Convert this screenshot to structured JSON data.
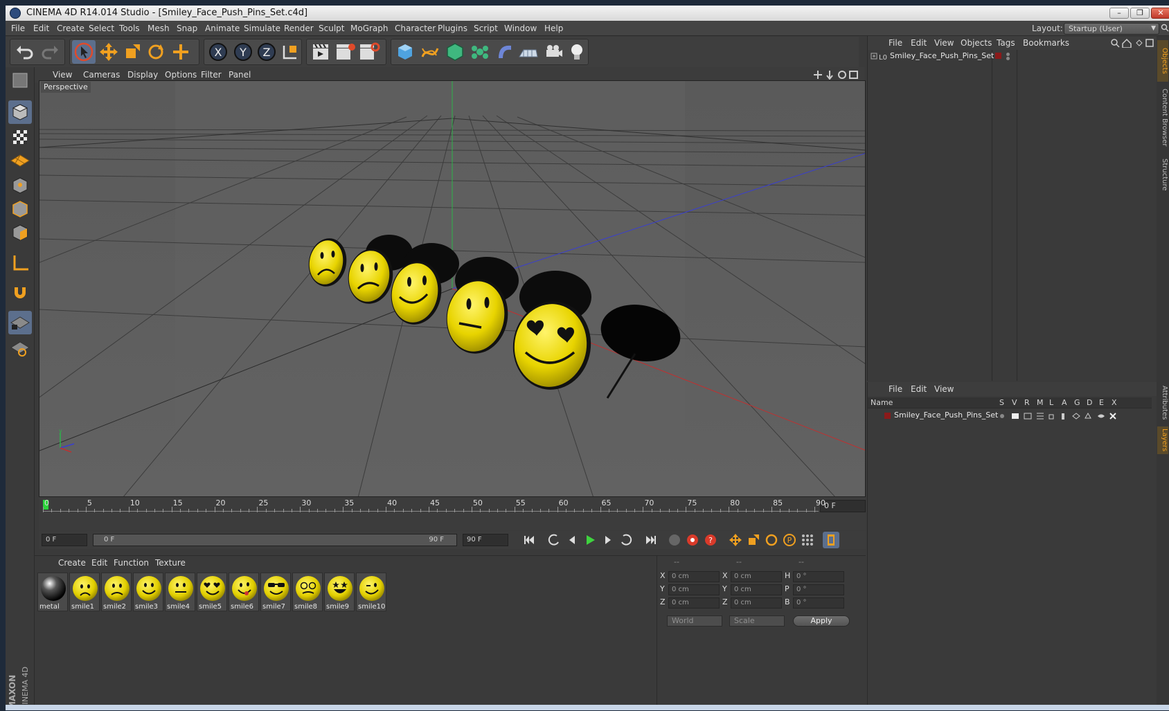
{
  "window": {
    "title": "CINEMA 4D R14.014 Studio - [Smiley_Face_Push_Pins_Set.c4d]",
    "minimize": "–",
    "restore": "❐",
    "close": "✕"
  },
  "menubar": {
    "items": [
      "File",
      "Edit",
      "Create",
      "Select",
      "Tools",
      "Mesh",
      "Snap",
      "Animate",
      "Simulate",
      "Render",
      "Sculpt",
      "MoGraph",
      "Character",
      "Plugins",
      "Script",
      "Window",
      "Help"
    ],
    "layout_label": "Layout:",
    "layout_value": "Startup (User)"
  },
  "viewport": {
    "menu": [
      "View",
      "Cameras",
      "Display",
      "Options",
      "Filter",
      "Panel"
    ],
    "label": "Perspective"
  },
  "timeline": {
    "ticks": [
      "0",
      "5",
      "10",
      "15",
      "20",
      "25",
      "30",
      "35",
      "40",
      "45",
      "50",
      "55",
      "60",
      "65",
      "70",
      "75",
      "80",
      "85",
      "90"
    ],
    "current_frame": "0 F",
    "start_field": "0 F",
    "range_start": "0 F",
    "range_end": "90 F",
    "end_field": "90 F"
  },
  "materials": {
    "menu": [
      "Create",
      "Edit",
      "Function",
      "Texture"
    ],
    "items": [
      {
        "name": "metal",
        "kind": "metal"
      },
      {
        "name": "smile1",
        "kind": "sad"
      },
      {
        "name": "smile2",
        "kind": "frown"
      },
      {
        "name": "smile3",
        "kind": "smile"
      },
      {
        "name": "smile4",
        "kind": "neutral"
      },
      {
        "name": "smile5",
        "kind": "hearts"
      },
      {
        "name": "smile6",
        "kind": "tongue"
      },
      {
        "name": "smile7",
        "kind": "glasses"
      },
      {
        "name": "smile8",
        "kind": "nerd"
      },
      {
        "name": "smile9",
        "kind": "stars"
      },
      {
        "name": "smile10",
        "kind": "wink"
      }
    ]
  },
  "coordinates": {
    "headers": [
      "--",
      "--",
      "--"
    ],
    "rows": [
      {
        "a": "X",
        "av": "0 cm",
        "b": "X",
        "bv": "0 cm",
        "c": "H",
        "cv": "0 °"
      },
      {
        "a": "Y",
        "av": "0 cm",
        "b": "Y",
        "bv": "0 cm",
        "c": "P",
        "cv": "0 °"
      },
      {
        "a": "Z",
        "av": "0 cm",
        "b": "Z",
        "bv": "0 cm",
        "c": "B",
        "cv": "0 °"
      }
    ],
    "mode": "World",
    "type": "Scale",
    "apply": "Apply"
  },
  "objects_panel": {
    "menu": [
      "File",
      "Edit",
      "View",
      "Objects",
      "Tags",
      "Bookmarks"
    ],
    "root_name": "Smiley_Face_Push_Pins_Set",
    "layer_color": "#8b1a1a"
  },
  "layers_panel": {
    "menu": [
      "File",
      "Edit",
      "View"
    ],
    "columns": [
      "Name",
      "S",
      "V",
      "R",
      "M",
      "L",
      "A",
      "G",
      "D",
      "E",
      "X"
    ],
    "row_name": "Smiley_Face_Push_Pins_Set"
  },
  "side_tabs": [
    "Objects",
    "Content Browser",
    "Structure",
    "Attributes",
    "Layers"
  ],
  "brand": {
    "line1": "MAXON",
    "line2": "CINEMA 4D"
  }
}
